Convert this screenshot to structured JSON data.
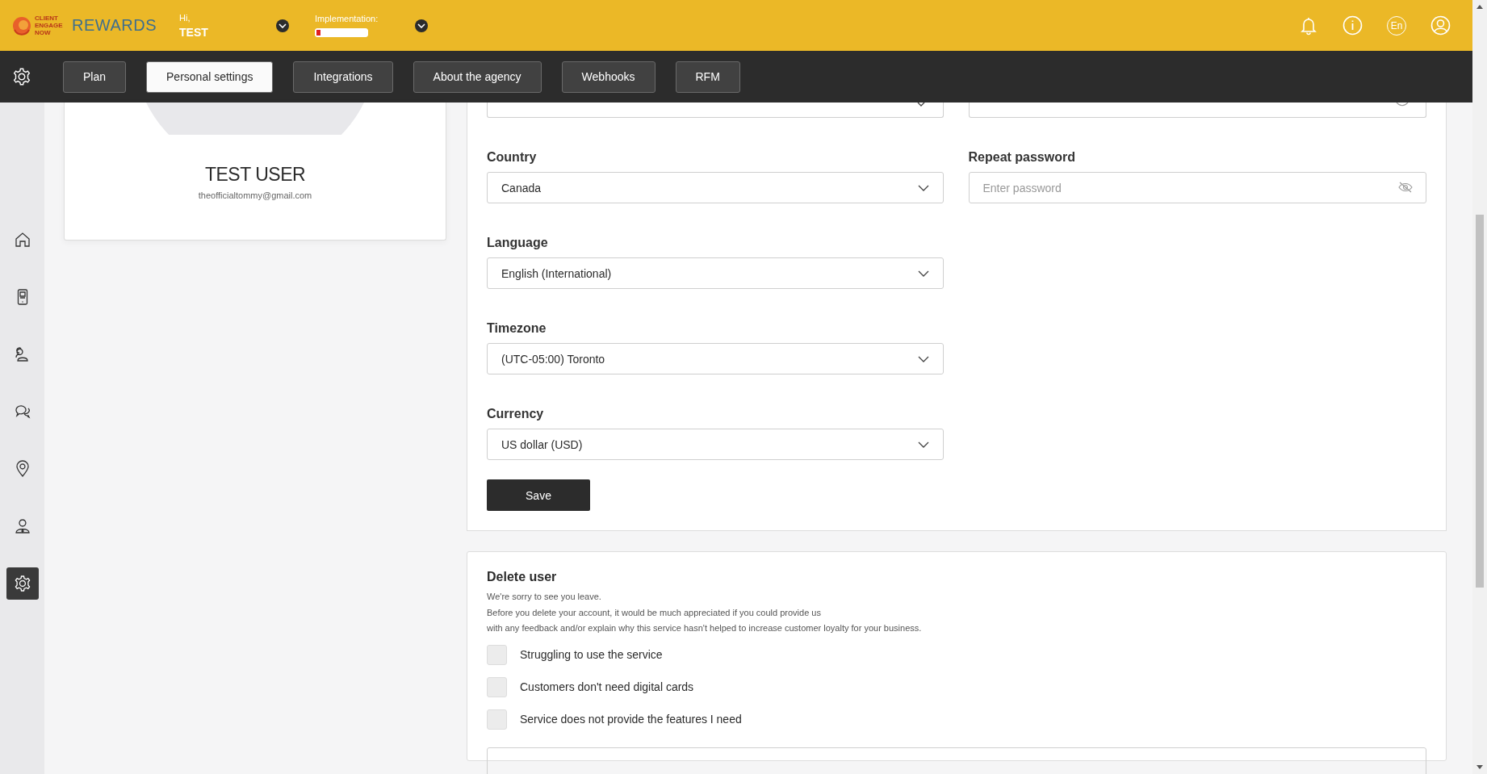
{
  "header": {
    "logo_small": "CLIENT ENGAGE NOW",
    "logo": "REWARDS",
    "greeting": "Hi,",
    "user": "TEST",
    "implementation": {
      "label": "Implementation:",
      "level": 0.08
    },
    "language_badge": "En"
  },
  "tabs": [
    {
      "label": "Plan",
      "selected": false
    },
    {
      "label": "Personal settings",
      "selected": true
    },
    {
      "label": "Integrations",
      "selected": false
    },
    {
      "label": "About the agency",
      "selected": false
    },
    {
      "label": "Webhooks",
      "selected": false
    },
    {
      "label": "RFM",
      "selected": false
    }
  ],
  "sidebar": [
    {
      "kind": "home",
      "selected": false
    },
    {
      "kind": "phone",
      "selected": false
    },
    {
      "kind": "users",
      "selected": false
    },
    {
      "kind": "chat",
      "selected": false
    },
    {
      "kind": "pin",
      "selected": false
    },
    {
      "kind": "person",
      "selected": false
    },
    {
      "kind": "gear",
      "selected": true
    }
  ],
  "profile": {
    "name": "TEST USER",
    "email": "theofficialtommy@gmail.com"
  },
  "form": {
    "left": [
      {
        "label": "Country",
        "value": "Canada"
      },
      {
        "label": "Language",
        "value": "English (International)"
      },
      {
        "label": "Timezone",
        "value": "(UTC-05:00) Toronto"
      },
      {
        "label": "Currency",
        "value": "US dollar (USD)"
      }
    ],
    "right": [
      {
        "label": "Repeat password",
        "placeholder": "Enter password"
      }
    ],
    "save": "Save"
  },
  "delete_user": {
    "title": "Delete user",
    "text": [
      "We're sorry to see you leave.",
      "Before you delete your account, it would be much appreciated if you could provide us",
      "with any feedback and/or explain why this service hasn't helped to increase customer loyalty for your business."
    ],
    "reasons": [
      {
        "label": "Struggling to use the service",
        "checked": false
      },
      {
        "label": "Customers don't need digital cards",
        "checked": false
      },
      {
        "label": "Service does not provide the features I need",
        "checked": false
      }
    ]
  }
}
